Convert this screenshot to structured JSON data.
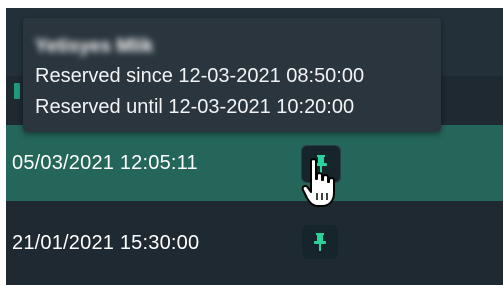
{
  "colors": {
    "panel_bg": "#1e2931",
    "selected_row_bg": "#246659",
    "accent_green": "#29d39b",
    "tooltip_bg": "#2a353d"
  },
  "tooltip": {
    "user_name": "Yetisyes Mlik",
    "reserved_since": "Reserved since 12-03-2021 08:50:00",
    "reserved_until": "Reserved until 12-03-2021 10:20:00"
  },
  "rows": [
    {
      "date": "05/03/2021 12:05:11",
      "icon": "pin-icon",
      "selected": true
    },
    {
      "date": "21/01/2021 15:30:00",
      "icon": "pin-icon",
      "selected": false
    }
  ],
  "cursor": "hand-pointer-icon"
}
